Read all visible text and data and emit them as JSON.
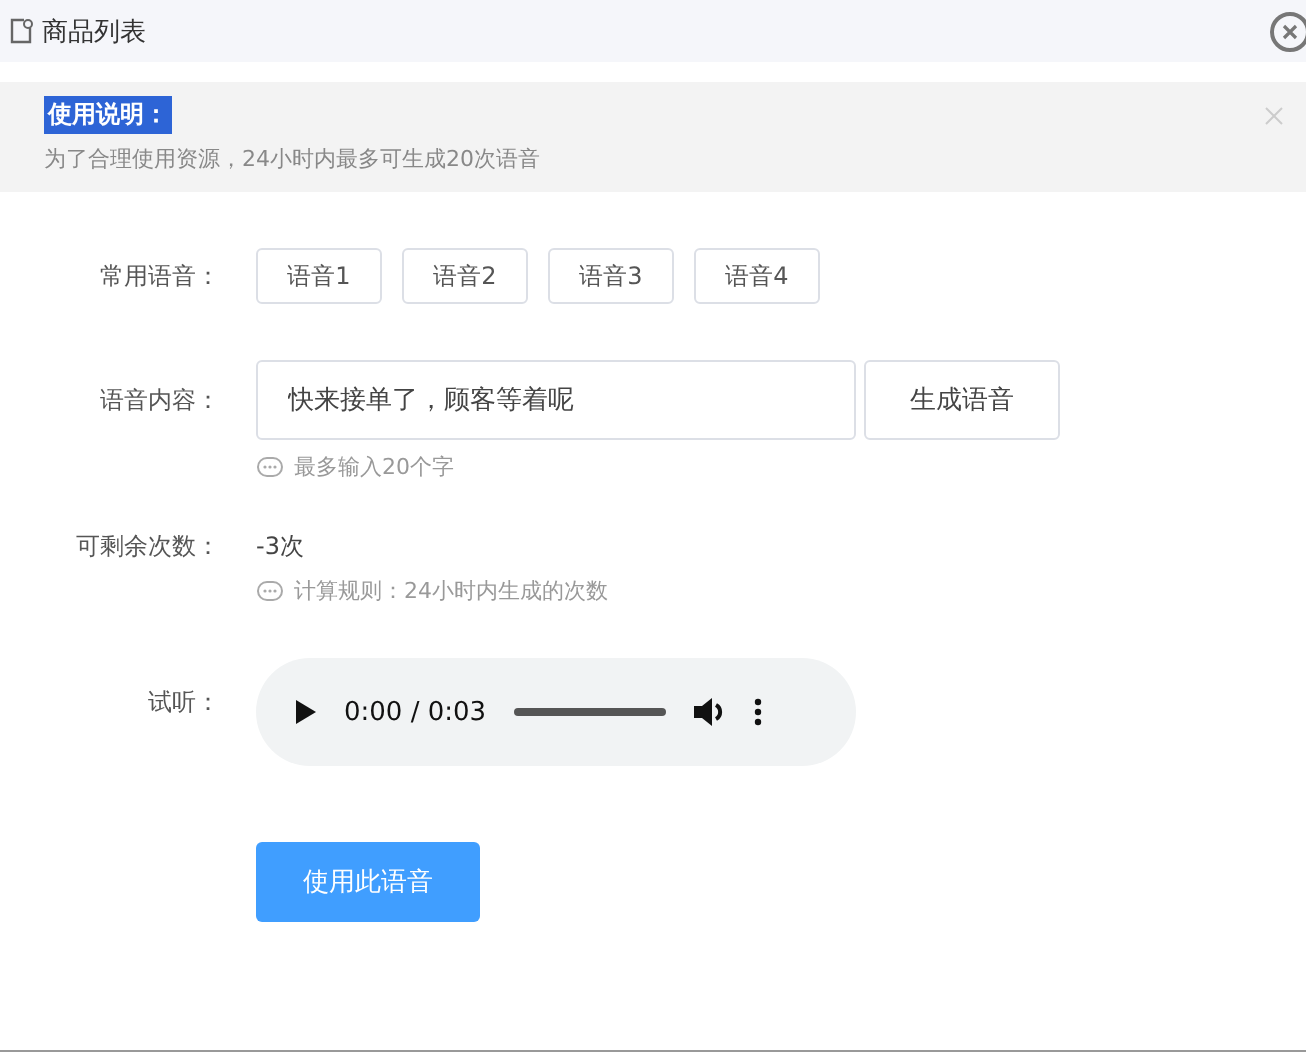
{
  "window": {
    "title": "商品列表"
  },
  "notice": {
    "title": "使用说明：",
    "title_highlighted": true,
    "text": "为了合理使用资源，24小时内最多可生成20次语音"
  },
  "form": {
    "presets": {
      "label": "常用语音：",
      "items": [
        "语音1",
        "语音2",
        "语音3",
        "语音4"
      ]
    },
    "content": {
      "label": "语音内容：",
      "value": "快来接单了，顾客等着呢",
      "button": "生成语音",
      "hint": "最多输入20个字"
    },
    "remaining": {
      "label": "可剩余次数：",
      "value": "-3次",
      "hint": "计算规则：24小时内生成的次数"
    },
    "preview": {
      "label": "试听：",
      "time": "0:00 / 0:03"
    },
    "submit": "使用此语音"
  }
}
